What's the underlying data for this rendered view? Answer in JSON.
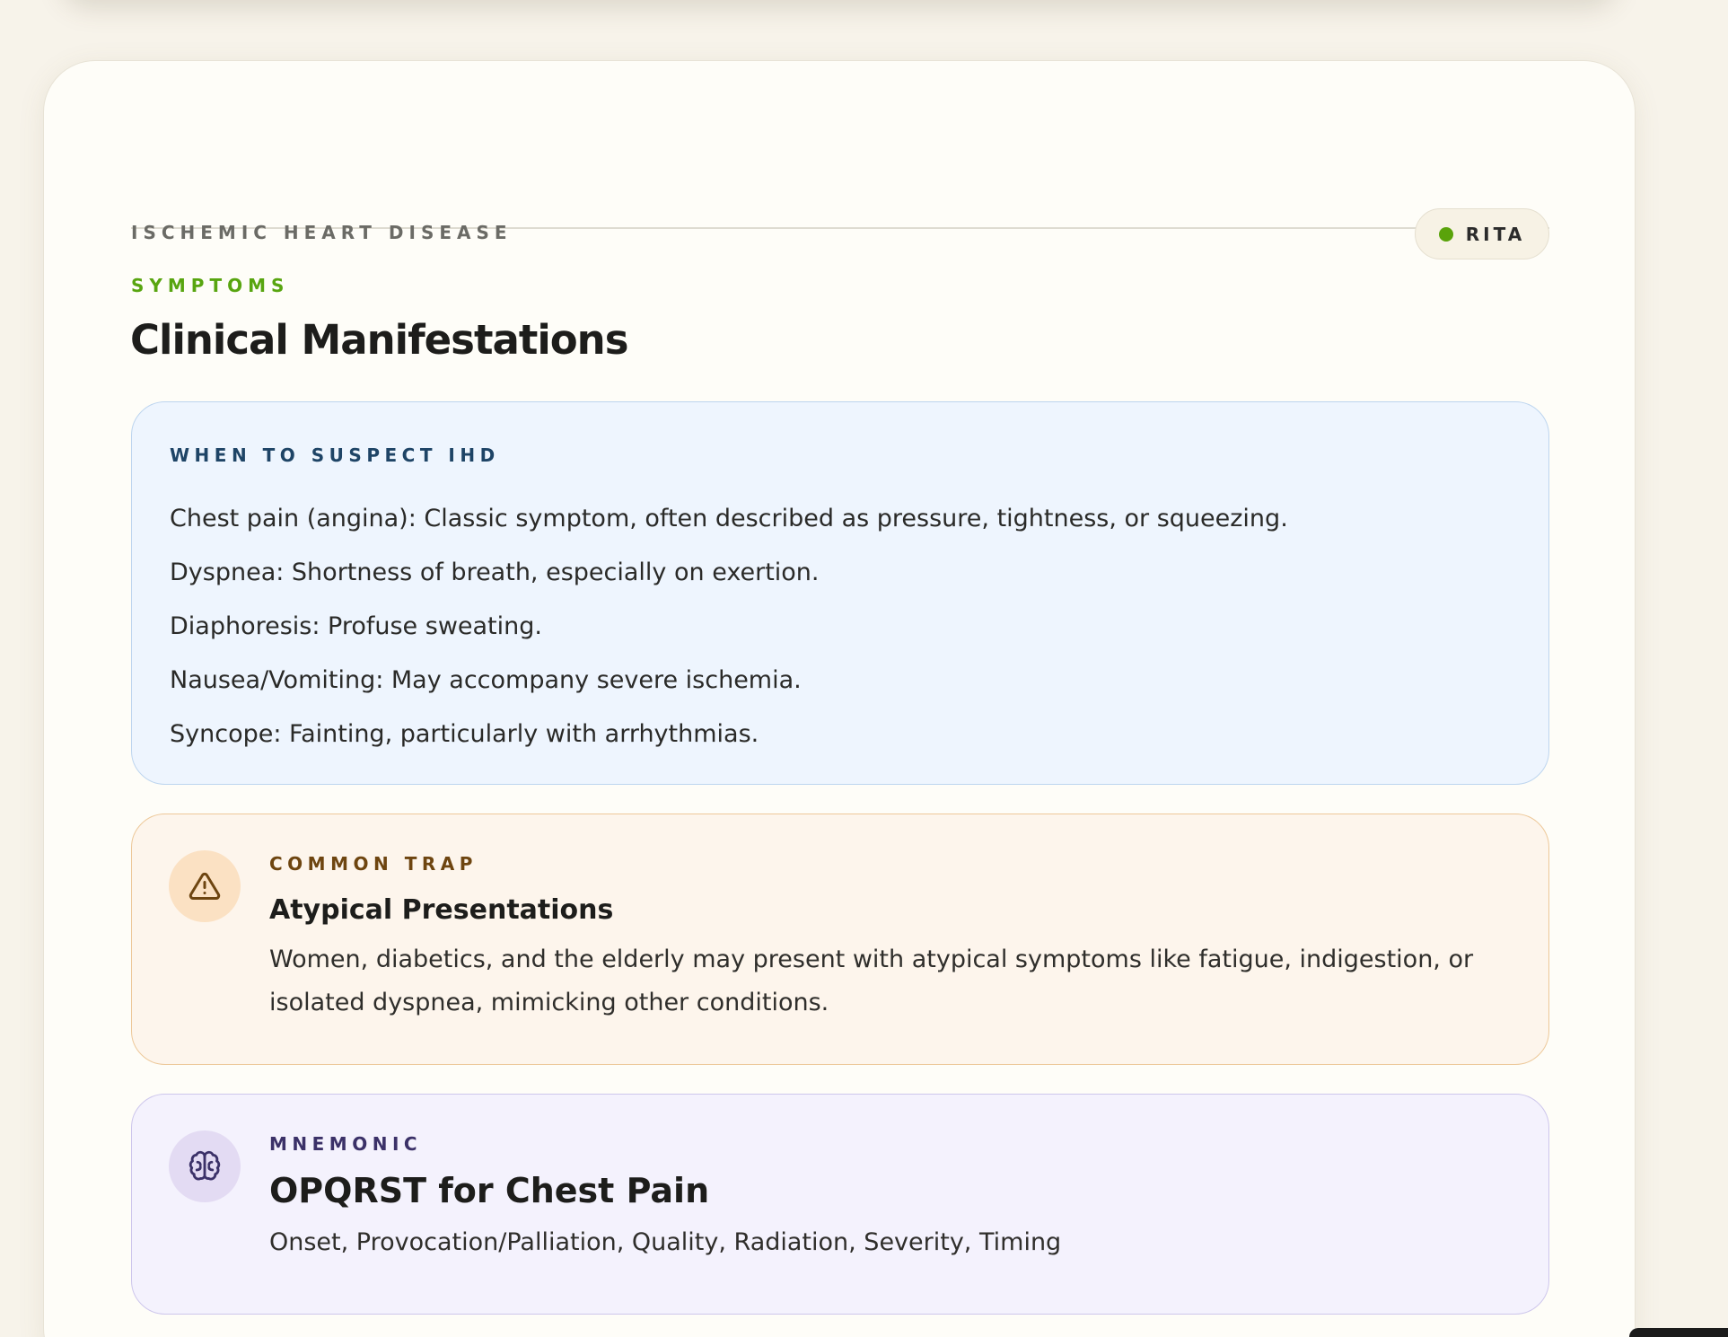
{
  "header": {
    "eyebrow": "ISCHEMIC HEART DISEASE",
    "badge_label": "RITA",
    "badge_color": "#5aa30b"
  },
  "section": {
    "eyebrow": "SYMPTOMS",
    "title": "Clinical Manifestations"
  },
  "suspect_box": {
    "eyebrow": "WHEN TO SUSPECT IHD",
    "items": [
      "Chest pain (angina): Classic symptom, often described as pressure, tightness, or squeezing.",
      "Dyspnea: Shortness of breath, especially on exertion.",
      "Diaphoresis: Profuse sweating.",
      "Nausea/Vomiting: May accompany severe ischemia.",
      "Syncope: Fainting, particularly with arrhythmias."
    ]
  },
  "trap_box": {
    "icon": "warning-triangle-icon",
    "eyebrow": "COMMON TRAP",
    "title": "Atypical Presentations",
    "body": "Women, diabetics, and the elderly may present with atypical symptoms like fatigue, indigestion, or isolated dyspnea, mimicking other conditions."
  },
  "mnemonic_box": {
    "icon": "brain-icon",
    "eyebrow": "MNEMONIC",
    "title": "OPQRST for Chest Pain",
    "body": "Onset, Provocation/Palliation, Quality, Radiation, Severity, Timing"
  }
}
